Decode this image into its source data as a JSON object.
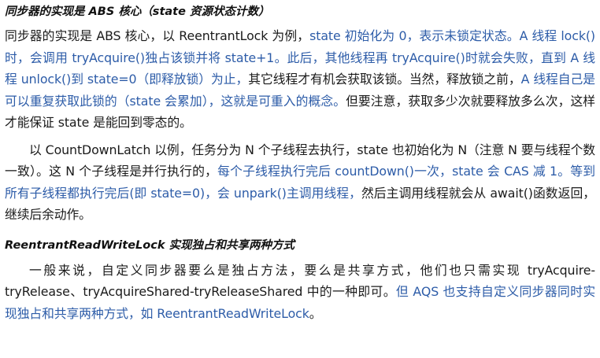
{
  "section1": {
    "heading": "同步器的实现是 ABS 核心（state 资源状态计数）",
    "paragraph1": [
      {
        "text": "同步器的实现是 ABS 核心，以 ReentrantLock 为例，",
        "color": "black"
      },
      {
        "text": "state 初始化为 0，表示未锁定状态。A 线程 lock()时，会调用 tryAcquire()独占该锁并将 state+1。此后，其他线程再 tryAcquire()时就会失败，直到 A 线程 unlock()到 state=0（即释放锁）为止，",
        "color": "blue"
      },
      {
        "text": "其它线程才有机会获取该锁。当然，释放锁之前，",
        "color": "black"
      },
      {
        "text": "A 线程自己是可以重复获取此锁的（state 会累加），这就是可重入的概念。",
        "color": "blue"
      },
      {
        "text": "但要注意，获取多少次就要释放多么次，这样才能保证 state 是能回到零态的。",
        "color": "black"
      }
    ],
    "paragraph2": [
      {
        "text": "以 CountDownLatch 以例，任务分为 N 个子线程去执行，state 也初始化为 N（注意 N 要与线程个数一致）。这 N 个子线程是并行执行的，",
        "color": "black"
      },
      {
        "text": "每个子线程执行完后 countDown()一次，state 会 CAS 减 1。等到所有子线程都执行完后(即 state=0)，会 unpark()主调用线程，",
        "color": "blue"
      },
      {
        "text": "然后主调用线程就会从 await()函数返回，继续后余动作。",
        "color": "black"
      }
    ]
  },
  "section2": {
    "heading": "ReentrantReadWriteLock 实现独占和共享两种方式",
    "paragraph1": [
      {
        "text": "一般来说，自定义同步器要么是独占方法，要么是共享方式，他们也只需实现 tryAcquire-tryRelease、tryAcquireShared-tryReleaseShared 中的一种即可。",
        "color": "black"
      },
      {
        "text": "但 AQS 也支持自定义同步器同时实现独占和共享两种方式，如 ReentrantReadWriteLock",
        "color": "blue"
      },
      {
        "text": "。",
        "color": "black"
      }
    ]
  }
}
